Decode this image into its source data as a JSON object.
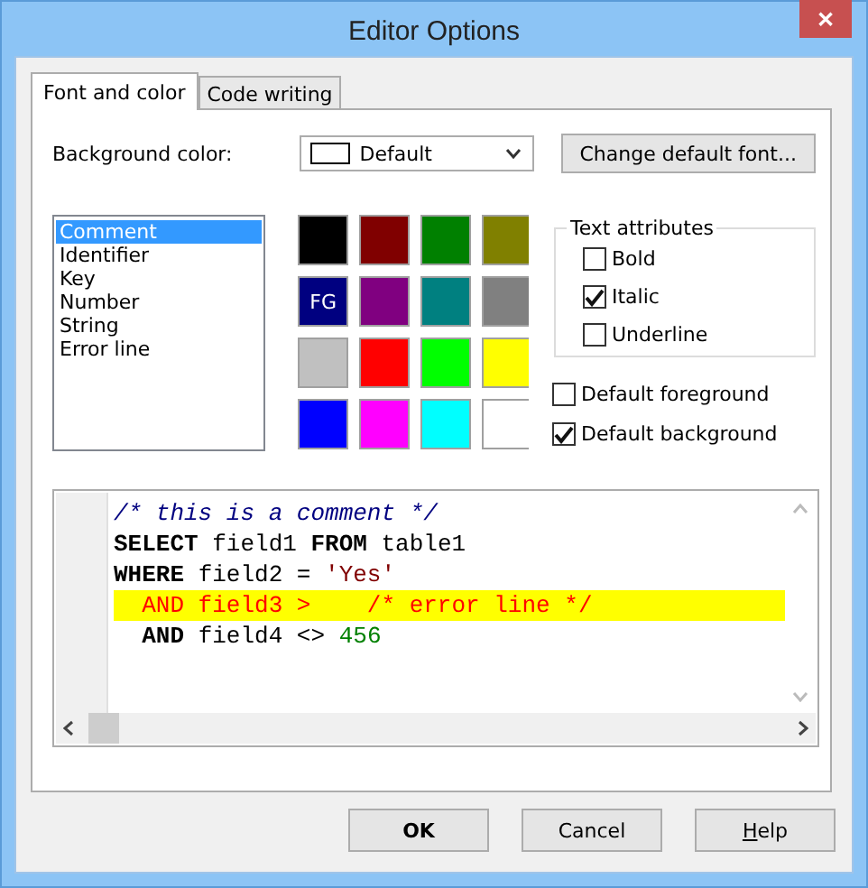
{
  "window": {
    "title": "Editor Options",
    "close": "✕"
  },
  "tabs": [
    {
      "label": "Font and color",
      "selected": true
    },
    {
      "label": "Code writing",
      "selected": false
    }
  ],
  "background_color": {
    "label": "Background color:",
    "value": "Default",
    "color": "#ffffff"
  },
  "change_font_button": "Change default font...",
  "elements": [
    {
      "label": "Comment",
      "selected": true
    },
    {
      "label": "Identifier",
      "selected": false
    },
    {
      "label": "Key",
      "selected": false
    },
    {
      "label": "Number",
      "selected": false
    },
    {
      "label": "String",
      "selected": false
    },
    {
      "label": "Error line",
      "selected": false
    }
  ],
  "swatches": [
    {
      "color": "#000000"
    },
    {
      "color": "#800000"
    },
    {
      "color": "#008000"
    },
    {
      "color": "#808000"
    },
    {
      "color": "#000080",
      "label": "FG"
    },
    {
      "color": "#800080"
    },
    {
      "color": "#008080"
    },
    {
      "color": "#808080"
    },
    {
      "color": "#c0c0c0"
    },
    {
      "color": "#ff0000"
    },
    {
      "color": "#00ff00"
    },
    {
      "color": "#ffff00"
    },
    {
      "color": "#0000ff"
    },
    {
      "color": "#ff00ff"
    },
    {
      "color": "#00ffff"
    },
    {
      "color": "#ffffff"
    }
  ],
  "text_attributes": {
    "title": "Text attributes",
    "options": [
      {
        "label": "Bold",
        "checked": false
      },
      {
        "label": "Italic",
        "checked": true
      },
      {
        "label": "Underline",
        "checked": false
      }
    ]
  },
  "defaults": [
    {
      "label": "Default foreground",
      "checked": false
    },
    {
      "label": "Default background",
      "checked": true
    }
  ],
  "preview": {
    "lines": [
      {
        "highlighted": false,
        "segments": [
          {
            "kind": "comment",
            "text": "/* this is a comment */"
          }
        ]
      },
      {
        "highlighted": false,
        "segments": [
          {
            "kind": "key",
            "text": "SELECT"
          },
          {
            "kind": "identifier",
            "text": " field1 "
          },
          {
            "kind": "key",
            "text": "FROM"
          },
          {
            "kind": "identifier",
            "text": " table1"
          }
        ]
      },
      {
        "highlighted": false,
        "segments": [
          {
            "kind": "key",
            "text": "WHERE"
          },
          {
            "kind": "identifier",
            "text": " field2 = "
          },
          {
            "kind": "string",
            "text": "'Yes'"
          }
        ]
      },
      {
        "highlighted": true,
        "segments": [
          {
            "kind": "error",
            "text": "  AND field3 >    /* error line */"
          }
        ]
      },
      {
        "highlighted": false,
        "segments": [
          {
            "kind": "key",
            "text": "  AND"
          },
          {
            "kind": "identifier",
            "text": " field4 <> "
          },
          {
            "kind": "number",
            "text": "456"
          }
        ]
      }
    ]
  },
  "buttons": [
    {
      "kind": "default",
      "label": "OK"
    },
    {
      "kind": "plain",
      "label": "Cancel"
    },
    {
      "kind": "mnemonic",
      "accel": "H",
      "label": "elp"
    }
  ]
}
